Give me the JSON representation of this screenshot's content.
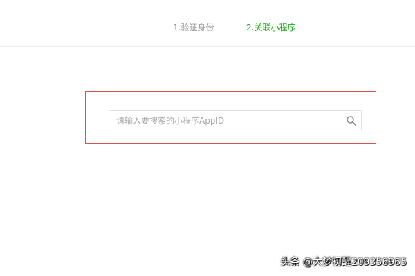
{
  "steps": {
    "step1_label": "1.验证身份",
    "step2_label": "2.关联小程序",
    "active_color": "#1aad19",
    "inactive_color": "#9a9a9a"
  },
  "search": {
    "placeholder": "请输入要搜索的小程序AppID",
    "value": "",
    "icon": "search-icon"
  },
  "highlight_color": "#d9534f",
  "watermark": "头条 @大梦初醒209356965"
}
